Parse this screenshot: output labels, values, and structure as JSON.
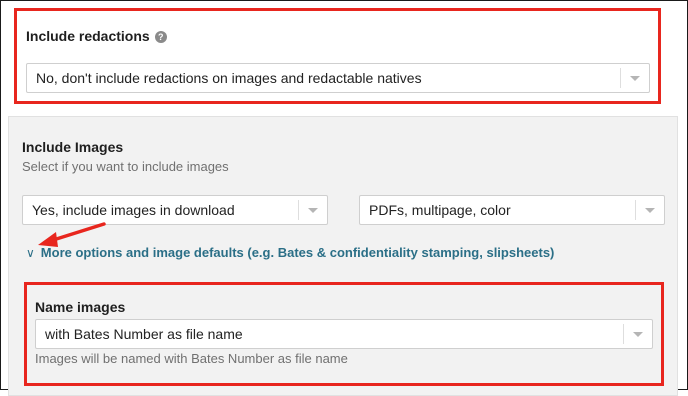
{
  "redactions": {
    "label": "Include redactions",
    "help_icon": "question-circle-icon",
    "select_value": "No, don't include redactions on images and redactable natives"
  },
  "images": {
    "label": "Include Images",
    "subtitle": "Select if you want to include images",
    "select_include_value": "Yes, include images in download",
    "select_format_value": "PDFs, multipage, color",
    "more_options_link": "More options and image defaults (e.g. Bates & confidentiality stamping, slipsheets)",
    "more_options_icon": "chevron-down-icon"
  },
  "name_images": {
    "label": "Name images",
    "select_value": "with Bates Number as file name",
    "hint": "Images will be named with Bates Number as file name"
  },
  "colors": {
    "highlight_red": "#e8261e",
    "link": "#2b6f87",
    "panel_bg": "#f2f2f2"
  }
}
